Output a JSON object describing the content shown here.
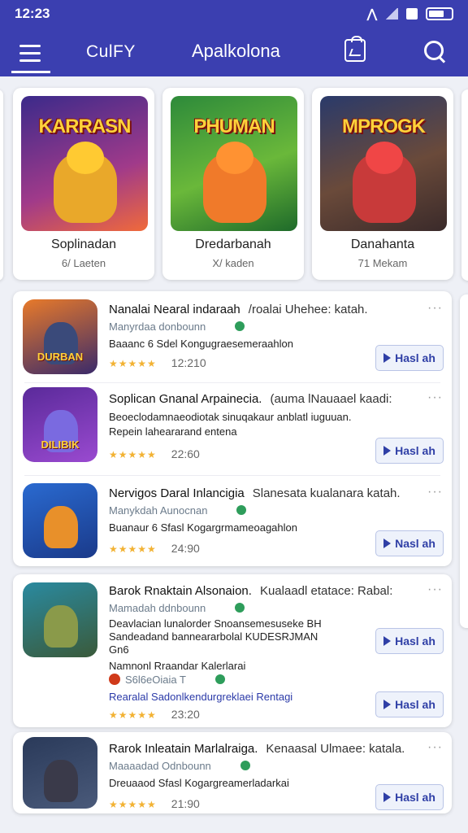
{
  "status": {
    "time": "12:23"
  },
  "appbar": {
    "brand": "CulFY",
    "title": "Apalkolona"
  },
  "featured": [
    {
      "banner": "KARRASN",
      "name": "Soplinadan",
      "count": "6/ Laeten",
      "bg": "linear-gradient(160deg,#3b2a8a,#a03a8a 60%,#f06a3a)",
      "hero": "#e9a82a"
    },
    {
      "banner": "PHUMAN",
      "name": "Dredarbanah",
      "count": "X/ kaden",
      "bg": "linear-gradient(160deg,#2d8a3a,#6ab83a 55%,#1e6a2a)",
      "hero": "#f07a2a"
    },
    {
      "banner": "MPROGK",
      "name": "Danahanta",
      "count": "71 Mekam",
      "bg": "linear-gradient(160deg,#2a3a6a,#6a4a3a 55%,#3a2a2a)",
      "hero": "#c83a3a"
    }
  ],
  "list": [
    {
      "title": "Nanalai Nearal indaraah",
      "alt": "/roalai Uhehee: katah.",
      "sub": "Manyrdaa donbounn",
      "desc": [
        "Baaanc 6 Sdel Kongugraesemeraahlon"
      ],
      "rating": "12:210",
      "install": "Hasl ah",
      "label": "DURBAN",
      "bg": "linear-gradient(160deg,#e87a2a,#3a2a6a)",
      "fig": "#3a4a7a"
    },
    {
      "title": "Soplican Gnanal Arpainecia.",
      "alt": "(auma lNauaael kaadi:",
      "sub": "",
      "desc": [
        "Beoeclodamnaeodiotak sinuqakaur anblatl iuguuan.",
        "Repein laheararand entena"
      ],
      "rating": "22:60",
      "install": "Hasl ah",
      "label": "DILIBIK",
      "bg": "linear-gradient(160deg,#5a2a9a,#9a4ad0)",
      "fig": "#7a6ae0"
    },
    {
      "title": "Nervigos Daral Inlancigia",
      "alt": "Slanesata kualanara katah.",
      "sub": "Manykdah Aunocnan",
      "desc": [
        "Buanaur 6 Sfasl Kogargrmameoagahlon"
      ],
      "rating": "24:90",
      "install": "Nasl ah",
      "label": "",
      "bg": "linear-gradient(160deg,#2a6ad0,#1a3a8a)",
      "fig": "#e8902a"
    }
  ],
  "card2": {
    "title": "Barok Rnaktain Alsonaion.",
    "alt": "Kualaadl etatace: Rabal:",
    "sub": "Mamadah ddnbounn",
    "desc": [
      "Deavlacian lunalorder Snoansemesuseke BH",
      "Sandeadand banneararbolal KUDESRJMAN",
      "Gn6"
    ],
    "extra": "Namnonl Rraandar Kalerlarai",
    "extra_sub": "S6l6eOiaia T",
    "blue": "Rearalal Sadonlkendurgreklaei Rentagi",
    "rating": "23:20",
    "install1": "Hasl ah",
    "install2": "Hasl ah",
    "bg": "linear-gradient(160deg,#2a8aa0,#3a5a3a)",
    "fig": "#8a9a4a",
    "label": ""
  },
  "card3": {
    "title": "Rarok Inleatain Marlalraiga.",
    "alt": "Kenaasal Ulmaee: katala.",
    "sub": "Maaaadad Odnbounn",
    "desc": [
      "Dreuaaod Sfasl Kogargreamerladarkai"
    ],
    "rating": "21:90",
    "install": "Hasl ah",
    "bg": "linear-gradient(160deg,#2a3a5a,#4a5a7a)",
    "fig": "#3a3a4a",
    "label": ""
  }
}
